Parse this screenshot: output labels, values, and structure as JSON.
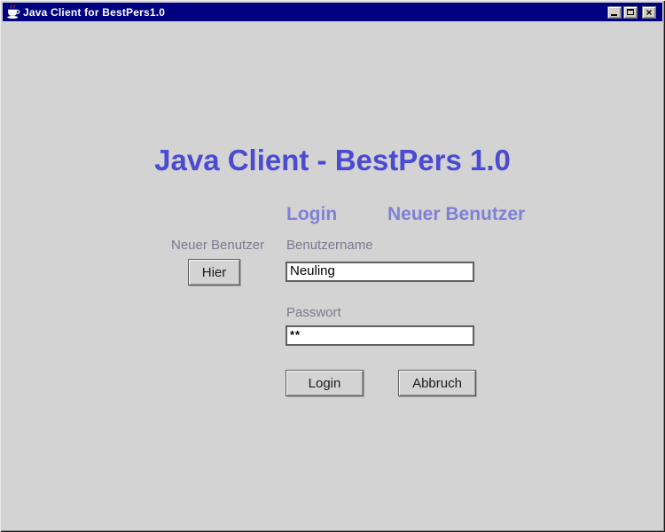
{
  "window": {
    "title": "Java Client for BestPers1.0"
  },
  "icons": {
    "app_icon": "java-coffee-cup-icon",
    "minimize": "minimize-icon",
    "maximize": "maximize-icon",
    "close": "close-icon"
  },
  "heading": "Java Client - BestPers 1.0",
  "form": {
    "login_header": "Login",
    "new_user_header": "Neuer Benutzer",
    "new_user_label": "Neuer Benutzer",
    "hier_button": "Hier",
    "username_label": "Benutzername",
    "username_value": "Neuling",
    "password_label": "Passwort",
    "password_value": "**",
    "login_button": "Login",
    "cancel_button": "Abbruch"
  },
  "colors": {
    "titlebar": "#000080",
    "heading": "#4a4ad2",
    "section_header": "#8080d4",
    "label": "#7b7b8e",
    "background": "#d3d3d3"
  }
}
